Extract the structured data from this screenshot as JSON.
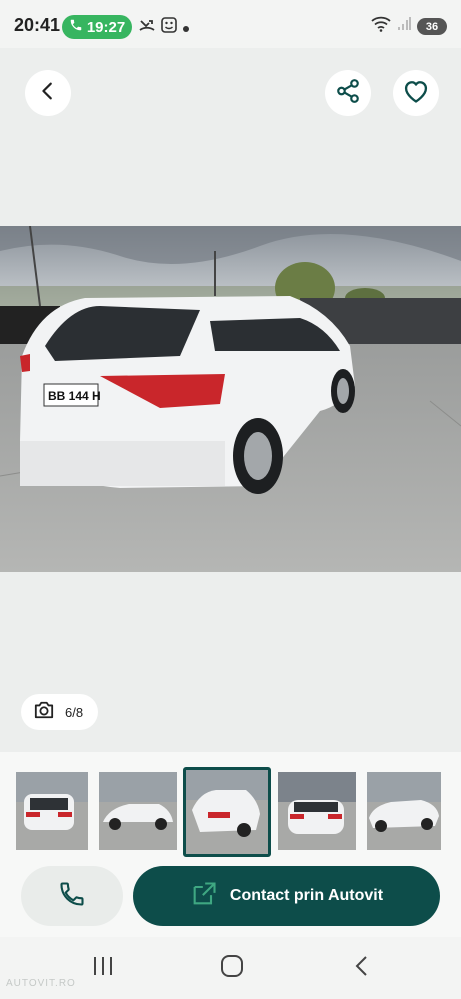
{
  "status_bar": {
    "time": "20:41",
    "call_duration": "19:27",
    "battery": "36"
  },
  "header": {
    "back_icon": "chevron-left-icon",
    "share_icon": "share-icon",
    "favorite_icon": "heart-icon"
  },
  "gallery": {
    "counter": "6/8",
    "camera_icon": "camera-icon",
    "plate_text": "BB 144 H"
  },
  "actions": {
    "contact_label": "Contact prin Autovit",
    "call_icon": "phone-icon",
    "external_icon": "external-link-icon"
  },
  "watermark": "AUTOVIT.RO",
  "colors": {
    "primary": "#0d4d4a",
    "call_pill": "#37b560",
    "background": "#eceeed"
  }
}
